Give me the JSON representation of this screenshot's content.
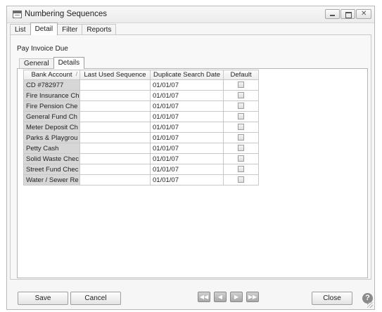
{
  "window": {
    "title": "Numbering Sequences",
    "icon": "table-icon"
  },
  "top_tabs": [
    "List",
    "Detail",
    "Filter",
    "Reports"
  ],
  "top_tab_active": "Detail",
  "form_title": "Pay Invoice Due",
  "inner_tabs": [
    "General",
    "Details"
  ],
  "inner_tab_active": "Details",
  "grid": {
    "columns": [
      "Bank Account",
      "Last Used Sequence",
      "Duplicate Search Date",
      "Default"
    ],
    "sorted_column": "Bank Account",
    "rows": [
      {
        "bank": "CD #782977",
        "last": "",
        "dup": "01/01/07",
        "default": false
      },
      {
        "bank": "Fire Insurance Ch",
        "last": "",
        "dup": "01/01/07",
        "default": false
      },
      {
        "bank": "Fire Pension Che",
        "last": "",
        "dup": "01/01/07",
        "default": false
      },
      {
        "bank": "General Fund Ch",
        "last": "",
        "dup": "01/01/07",
        "default": false
      },
      {
        "bank": "Meter Deposit Ch",
        "last": "",
        "dup": "01/01/07",
        "default": false
      },
      {
        "bank": "Parks & Playgrou",
        "last": "",
        "dup": "01/01/07",
        "default": false
      },
      {
        "bank": "Petty Cash",
        "last": "",
        "dup": "01/01/07",
        "default": false
      },
      {
        "bank": "Solid Waste Chec",
        "last": "",
        "dup": "01/01/07",
        "default": false
      },
      {
        "bank": "Street Fund Chec",
        "last": "",
        "dup": "01/01/07",
        "default": false
      },
      {
        "bank": "Water / Sewer Re",
        "last": "",
        "dup": "01/01/07",
        "default": false
      }
    ]
  },
  "buttons": {
    "save": "Save",
    "cancel": "Cancel",
    "close": "Close"
  },
  "nav": {
    "first": "first-record-icon",
    "prev": "previous-record-icon",
    "next": "next-record-icon",
    "last": "last-record-icon",
    "first_glyph": "◀◀",
    "prev_glyph": "◀",
    "next_glyph": "▶",
    "last_glyph": "▶▶"
  },
  "help_glyph": "?",
  "colors": {
    "bank_column_bg": "#d7d7d7",
    "nav_button_bg": "#a8a8a8"
  }
}
